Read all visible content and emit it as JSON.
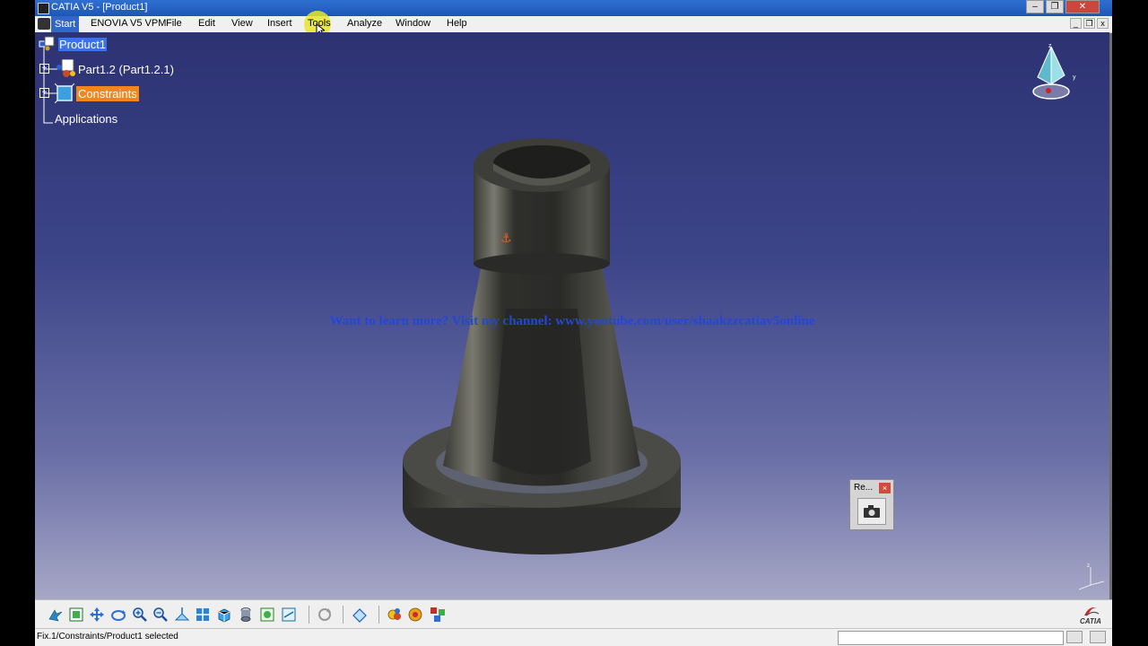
{
  "window": {
    "title": "CATIA V5 - [Product1]"
  },
  "menubar": {
    "items": [
      "Start",
      "ENOVIA V5 VPM",
      "File",
      "Edit",
      "View",
      "Insert",
      "Tools",
      "Analyze",
      "Window",
      "Help"
    ],
    "highlighted": "Tools"
  },
  "tree": {
    "root": "Product1",
    "part": "Part1.2 (Part1.2.1)",
    "constraints": "Constraints",
    "applications": "Applications"
  },
  "overlay": {
    "watermark": "Want to learn more? Visit my channel: www.youtube.com/user/shaakzzcatiav5online"
  },
  "mini_toolbar": {
    "title": "Re...",
    "close": "×"
  },
  "status": {
    "message": "Fix.1/Constraints/Product1 selected"
  },
  "logo": {
    "text": "CATIA"
  },
  "icons": [
    "fly-icon",
    "fit-all-icon",
    "pan-icon",
    "rotate-icon",
    "zoom-in-icon",
    "zoom-out-icon",
    "normal-view-icon",
    "multi-view-icon",
    "iso-view-icon",
    "render-style-icon",
    "hide-show-icon",
    "swap-space-icon",
    "refresh-icon",
    "measure-icon",
    "manipulate-icon",
    "snap-icon",
    "explode-icon"
  ]
}
